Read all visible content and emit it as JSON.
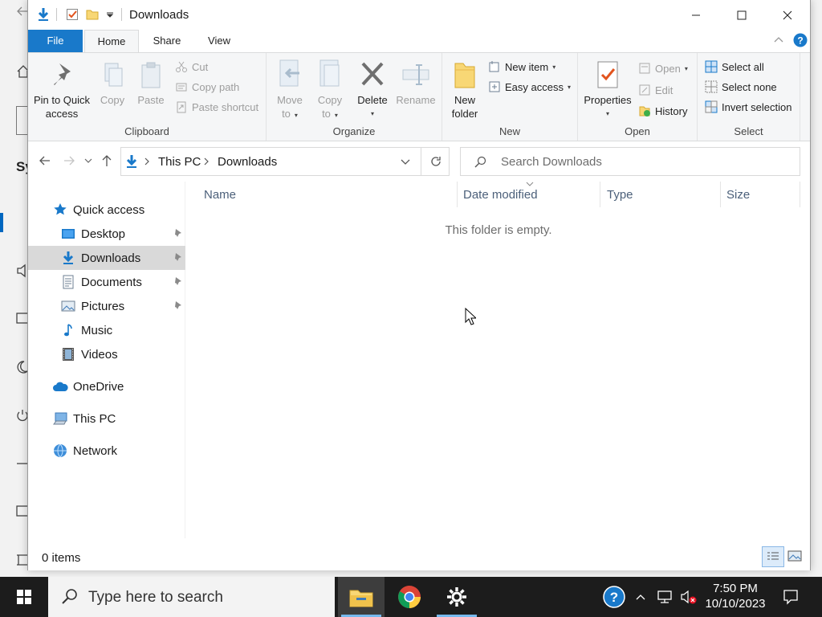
{
  "window": {
    "title": "Downloads"
  },
  "ribbon": {
    "tabs": [
      "File",
      "Home",
      "Share",
      "View"
    ],
    "clipboard": {
      "label": "Clipboard",
      "pin_line1": "Pin to Quick",
      "pin_line2": "access",
      "copy": "Copy",
      "paste": "Paste",
      "cut": "Cut",
      "copy_path": "Copy path",
      "paste_shortcut": "Paste shortcut"
    },
    "organize": {
      "label": "Organize",
      "move_line1": "Move",
      "move_line2": "to",
      "copy_line1": "Copy",
      "copy_line2": "to",
      "delete": "Delete",
      "rename": "Rename"
    },
    "new": {
      "label": "New",
      "folder_line1": "New",
      "folder_line2": "folder",
      "new_item": "New item",
      "easy_access": "Easy access"
    },
    "open": {
      "label": "Open",
      "properties": "Properties",
      "open": "Open",
      "edit": "Edit",
      "history": "History"
    },
    "select": {
      "label": "Select",
      "select_all": "Select all",
      "select_none": "Select none",
      "invert_selection": "Invert selection"
    }
  },
  "address": {
    "crumbs": [
      "This PC",
      "Downloads"
    ],
    "search_placeholder": "Search Downloads"
  },
  "nav": {
    "quick_access": "Quick access",
    "items": [
      {
        "label": "Desktop",
        "pinned": true
      },
      {
        "label": "Downloads",
        "pinned": true,
        "selected": true
      },
      {
        "label": "Documents",
        "pinned": true
      },
      {
        "label": "Pictures",
        "pinned": true
      },
      {
        "label": "Music",
        "pinned": false
      },
      {
        "label": "Videos",
        "pinned": false
      }
    ],
    "onedrive": "OneDrive",
    "this_pc": "This PC",
    "network": "Network"
  },
  "columns": [
    "Name",
    "Date modified",
    "Type",
    "Size"
  ],
  "content": {
    "empty_message": "This folder is empty."
  },
  "status": {
    "item_count": "0 items"
  },
  "taskbar": {
    "search_placeholder": "Type here to search",
    "time": "7:50 PM",
    "date": "10/10/2023"
  },
  "background": {
    "partial_text": "Sy"
  },
  "colors": {
    "accent": "#1979ca",
    "folder_yellow": "#f8d775",
    "taskbar": "#1c1c1c"
  }
}
